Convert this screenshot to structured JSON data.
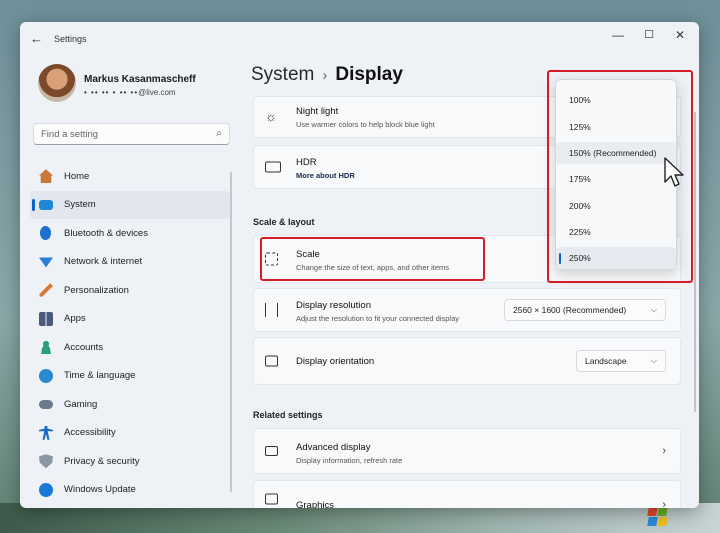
{
  "window": {
    "title": "Settings"
  },
  "user": {
    "name": "Markus Kasanmascheff",
    "email_suffix": "@live.com"
  },
  "search": {
    "placeholder": "Find a setting"
  },
  "sidebar": {
    "items": [
      {
        "label": "Home",
        "icon": "home-icon",
        "color": "#c8783a"
      },
      {
        "label": "System",
        "icon": "monitor-icon",
        "color": "#1e88d6",
        "active": true
      },
      {
        "label": "Bluetooth & devices",
        "icon": "bluetooth-icon",
        "color": "#1e6fd0"
      },
      {
        "label": "Network & internet",
        "icon": "wifi-icon",
        "color": "#2a7fd8"
      },
      {
        "label": "Personalization",
        "icon": "brush-icon",
        "color": "#d8783a"
      },
      {
        "label": "Apps",
        "icon": "apps-icon",
        "color": "#4a5a7a"
      },
      {
        "label": "Accounts",
        "icon": "person-icon",
        "color": "#2aa07a"
      },
      {
        "label": "Time & language",
        "icon": "globe-clock-icon",
        "color": "#2a8ad0"
      },
      {
        "label": "Gaming",
        "icon": "gamepad-icon",
        "color": "#6a7a8a"
      },
      {
        "label": "Accessibility",
        "icon": "accessibility-icon",
        "color": "#1a6ac8"
      },
      {
        "label": "Privacy & security",
        "icon": "shield-icon",
        "color": "#8a96a4"
      },
      {
        "label": "Windows Update",
        "icon": "update-icon",
        "color": "#1a7ad8"
      }
    ]
  },
  "breadcrumb": {
    "parent": "System",
    "separator": "›",
    "current": "Display"
  },
  "cards": {
    "night_light": {
      "title": "Night light",
      "desc": "Use warmer colors to help block blue light"
    },
    "hdr": {
      "title": "HDR",
      "link": "More about HDR"
    },
    "scale": {
      "title": "Scale",
      "desc": "Change the size of text, apps, and other items"
    },
    "resolution": {
      "title": "Display resolution",
      "desc": "Adjust the resolution to fit your connected display",
      "value": "2560 × 1600 (Recommended)"
    },
    "orientation": {
      "title": "Display orientation",
      "value": "Landscape"
    },
    "advanced": {
      "title": "Advanced display",
      "desc": "Display information, refresh rate"
    },
    "graphics": {
      "title": "Graphics"
    }
  },
  "sections": {
    "scale_layout": "Scale & layout",
    "related": "Related settings"
  },
  "scale_dropdown": {
    "options": [
      "100%",
      "125%",
      "150% (Recommended)",
      "175%",
      "200%",
      "225%",
      "250%"
    ],
    "selected": "250%",
    "hovered": "150% (Recommended)"
  },
  "colors": {
    "accent": "#0b63c5",
    "highlight": "#d41d27"
  }
}
